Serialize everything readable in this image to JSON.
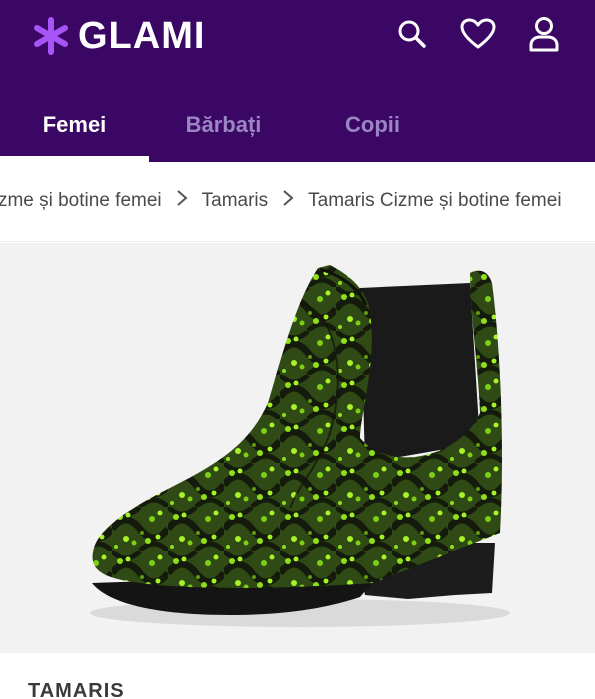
{
  "header": {
    "logo_text": "GLAMI",
    "logo_icon": "asterisk-star-icon",
    "brand_color": "#3b0764",
    "accent_color": "#a855f7",
    "icons": [
      "search-icon",
      "heart-icon",
      "user-icon"
    ]
  },
  "tabs": [
    {
      "label": "Femei",
      "active": true
    },
    {
      "label": "Bărbați",
      "active": false
    },
    {
      "label": "Copii",
      "active": false
    }
  ],
  "breadcrumb": {
    "items": [
      "Cizme și botine femei",
      "Tamaris",
      "Tamaris Cizme și botine femei"
    ],
    "separator_icon": "chevron-right-icon"
  },
  "product": {
    "image": "green-snakeskin-chelsea-ankle-boot",
    "brand": "TAMARIS"
  }
}
